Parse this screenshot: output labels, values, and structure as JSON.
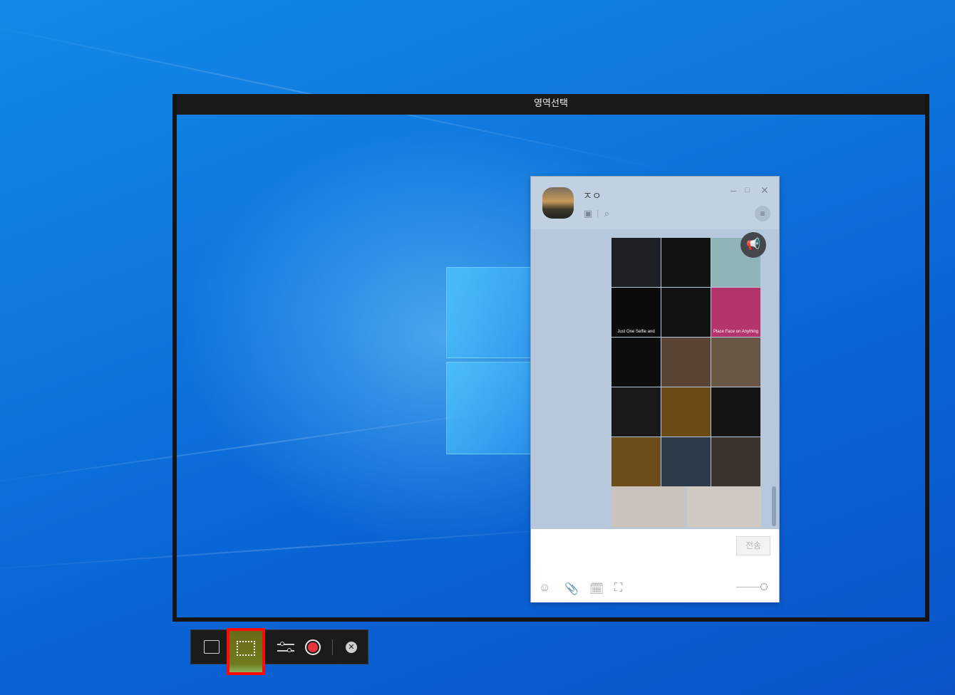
{
  "capture": {
    "title": "영역선택"
  },
  "chat": {
    "contact_name": "ㅈㅇ",
    "send_label": "전송",
    "photos": [
      {
        "caption": "",
        "color": "#1d2126"
      },
      {
        "caption": "",
        "color": "#101512"
      },
      {
        "caption": "",
        "color": "#8fb4b8"
      },
      {
        "caption": "Just One Selfie and",
        "color": "#0b0b0b"
      },
      {
        "caption": "",
        "color": "#121212"
      },
      {
        "caption": "Place Face on Anything",
        "color": "#b3356b"
      },
      {
        "caption": "",
        "color": "#0d0d0d"
      },
      {
        "caption": "",
        "color": "#5a4434"
      },
      {
        "caption": "",
        "color": "#6a5645"
      },
      {
        "caption": "",
        "color": "#1a1a1a"
      },
      {
        "caption": "",
        "color": "#6b4a16"
      },
      {
        "caption": "",
        "color": "#141414"
      },
      {
        "caption": "",
        "color": "#6b4e1b"
      },
      {
        "caption": "",
        "color": "#2d3b4a"
      },
      {
        "caption": "",
        "color": "#3b342c"
      }
    ],
    "photos_row2": [
      {
        "color": "#c9c3bb"
      },
      {
        "color": "#cfc9c2"
      }
    ]
  },
  "toolbar": {
    "selected_tool": "region-capture"
  },
  "icons": {
    "minimize": "minimize-icon",
    "maximize": "maximize-icon",
    "close": "close-icon",
    "menu": "hamburger-menu-icon",
    "search": "search-icon",
    "album": "album-icon",
    "megaphone": "megaphone-icon",
    "emoji": "emoji-icon",
    "attach": "paperclip-icon",
    "calendar": "calendar-icon",
    "capture": "screen-capture-icon"
  },
  "colors": {
    "record_red": "#e7353c",
    "highlight_red": "#ff0a0a"
  }
}
